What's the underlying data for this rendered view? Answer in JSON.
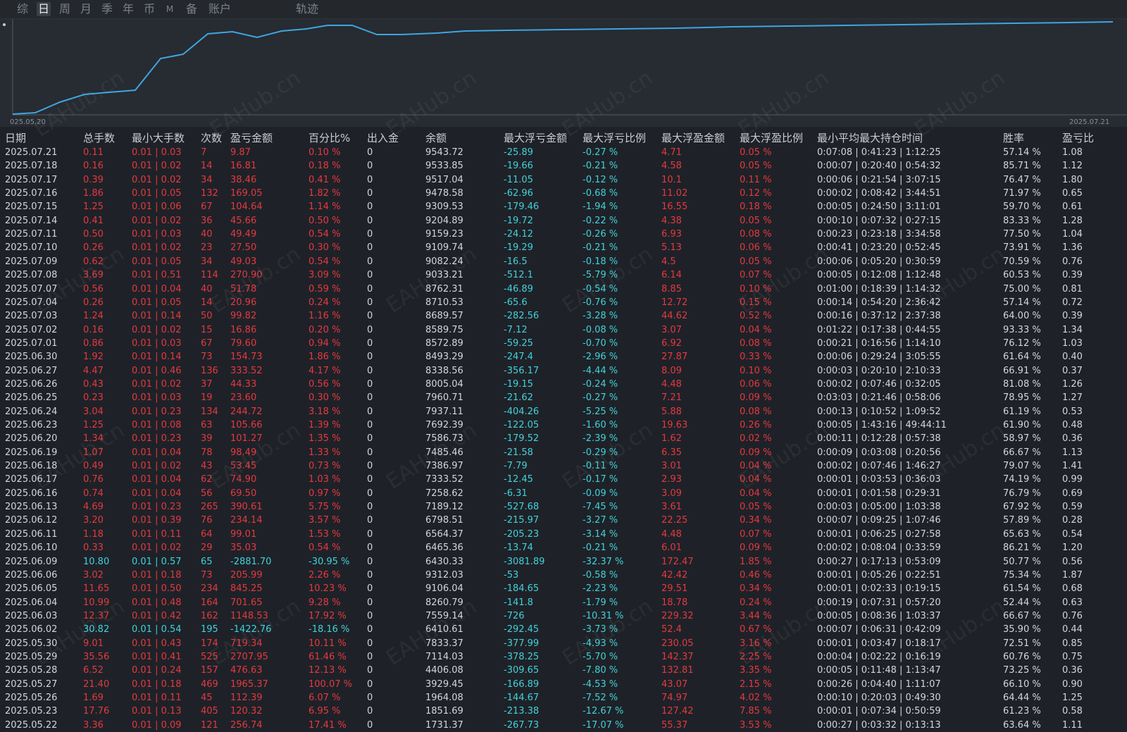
{
  "tabs": [
    "综",
    "日",
    "周",
    "月",
    "季",
    "年",
    "币",
    "M",
    "备",
    "账户",
    "轨迹"
  ],
  "active_tab": "日",
  "chart": {
    "start_date": "025.05.20",
    "end_date": "2025.07.21",
    "line_color": "#3ea6e0"
  },
  "watermark": "EAHub.cn",
  "columns": [
    "日期",
    "总手数",
    "最小大手数",
    "次数",
    "盈亏金额",
    "百分比%",
    "出入金",
    "余额",
    "最大浮亏金额",
    "最大浮亏比例",
    "最大浮盈金额",
    "最大浮盈比例",
    "最小平均最大持仓时间",
    "胜率",
    "盈亏比"
  ],
  "colors": {
    "profit": "#e5393f",
    "loss": "#42d1d9",
    "neutral": "#d3d6db"
  },
  "rows": [
    [
      "2025.07.21",
      "0.11",
      "0.01 | 0.03",
      "7",
      "9.87",
      "0.10 %",
      "0",
      "9543.72",
      "-25.89",
      "-0.27 %",
      "4.71",
      "0.05 %",
      "0:07:08 | 0:41:23 | 1:12:25",
      "57.14 %",
      "1.08"
    ],
    [
      "2025.07.18",
      "0.16",
      "0.01 | 0.02",
      "14",
      "16.81",
      "0.18 %",
      "0",
      "9533.85",
      "-19.66",
      "-0.21 %",
      "4.58",
      "0.05 %",
      "0:00:07 | 0:20:40 | 0:54:32",
      "85.71 %",
      "1.12"
    ],
    [
      "2025.07.17",
      "0.39",
      "0.01 | 0.02",
      "34",
      "38.46",
      "0.41 %",
      "0",
      "9517.04",
      "-11.05",
      "-0.12 %",
      "10.1",
      "0.11 %",
      "0:00:06 | 0:21:54 | 3:07:15",
      "76.47 %",
      "1.80"
    ],
    [
      "2025.07.16",
      "1.86",
      "0.01 | 0.05",
      "132",
      "169.05",
      "1.82 %",
      "0",
      "9478.58",
      "-62.96",
      "-0.68 %",
      "11.02",
      "0.12 %",
      "0:00:02 | 0:08:42 | 3:44:51",
      "71.97 %",
      "0.65"
    ],
    [
      "2025.07.15",
      "1.25",
      "0.01 | 0.06",
      "67",
      "104.64",
      "1.14 %",
      "0",
      "9309.53",
      "-179.46",
      "-1.94 %",
      "16.55",
      "0.18 %",
      "0:00:05 | 0:24:50 | 3:11:01",
      "59.70 %",
      "0.61"
    ],
    [
      "2025.07.14",
      "0.41",
      "0.01 | 0.02",
      "36",
      "45.66",
      "0.50 %",
      "0",
      "9204.89",
      "-19.72",
      "-0.22 %",
      "4.38",
      "0.05 %",
      "0:00:10 | 0:07:32 | 0:27:15",
      "83.33 %",
      "1.28"
    ],
    [
      "2025.07.11",
      "0.50",
      "0.01 | 0.03",
      "40",
      "49.49",
      "0.54 %",
      "0",
      "9159.23",
      "-24.12",
      "-0.26 %",
      "6.93",
      "0.08 %",
      "0:00:23 | 0:23:18 | 3:34:58",
      "77.50 %",
      "1.04"
    ],
    [
      "2025.07.10",
      "0.26",
      "0.01 | 0.02",
      "23",
      "27.50",
      "0.30 %",
      "0",
      "9109.74",
      "-19.29",
      "-0.21 %",
      "5.13",
      "0.06 %",
      "0:00:41 | 0:23:20 | 0:52:45",
      "73.91 %",
      "1.36"
    ],
    [
      "2025.07.09",
      "0.62",
      "0.01 | 0.05",
      "34",
      "49.03",
      "0.54 %",
      "0",
      "9082.24",
      "-16.5",
      "-0.18 %",
      "4.5",
      "0.05 %",
      "0:00:06 | 0:05:20 | 0:30:59",
      "70.59 %",
      "0.76"
    ],
    [
      "2025.07.08",
      "3.69",
      "0.01 | 0.51",
      "114",
      "270.90",
      "3.09 %",
      "0",
      "9033.21",
      "-512.1",
      "-5.79 %",
      "6.14",
      "0.07 %",
      "0:00:05 | 0:12:08 | 1:12:48",
      "60.53 %",
      "0.39"
    ],
    [
      "2025.07.07",
      "0.56",
      "0.01 | 0.04",
      "40",
      "51.78",
      "0.59 %",
      "0",
      "8762.31",
      "-46.89",
      "-0.54 %",
      "8.85",
      "0.10 %",
      "0:01:00 | 0:18:39 | 1:14:32",
      "75.00 %",
      "0.81"
    ],
    [
      "2025.07.04",
      "0.26",
      "0.01 | 0.05",
      "14",
      "20.96",
      "0.24 %",
      "0",
      "8710.53",
      "-65.6",
      "-0.76 %",
      "12.72",
      "0.15 %",
      "0:00:14 | 0:54:20 | 2:36:42",
      "57.14 %",
      "0.72"
    ],
    [
      "2025.07.03",
      "1.24",
      "0.01 | 0.14",
      "50",
      "99.82",
      "1.16 %",
      "0",
      "8689.57",
      "-282.56",
      "-3.28 %",
      "44.62",
      "0.52 %",
      "0:00:16 | 0:37:12 | 2:37:38",
      "64.00 %",
      "0.39"
    ],
    [
      "2025.07.02",
      "0.16",
      "0.01 | 0.02",
      "15",
      "16.86",
      "0.20 %",
      "0",
      "8589.75",
      "-7.12",
      "-0.08 %",
      "3.07",
      "0.04 %",
      "0:01:22 | 0:17:38 | 0:44:55",
      "93.33 %",
      "1.34"
    ],
    [
      "2025.07.01",
      "0.86",
      "0.01 | 0.03",
      "67",
      "79.60",
      "0.94 %",
      "0",
      "8572.89",
      "-59.25",
      "-0.70 %",
      "6.92",
      "0.08 %",
      "0:00:21 | 0:16:56 | 1:14:10",
      "76.12 %",
      "1.03"
    ],
    [
      "2025.06.30",
      "1.92",
      "0.01 | 0.14",
      "73",
      "154.73",
      "1.86 %",
      "0",
      "8493.29",
      "-247.4",
      "-2.96 %",
      "27.87",
      "0.33 %",
      "0:00:06 | 0:29:24 | 3:05:55",
      "61.64 %",
      "0.40"
    ],
    [
      "2025.06.27",
      "4.47",
      "0.01 | 0.46",
      "136",
      "333.52",
      "4.17 %",
      "0",
      "8338.56",
      "-356.17",
      "-4.44 %",
      "8.09",
      "0.10 %",
      "0:00:03 | 0:20:10 | 2:10:33",
      "66.91 %",
      "0.37"
    ],
    [
      "2025.06.26",
      "0.43",
      "0.01 | 0.02",
      "37",
      "44.33",
      "0.56 %",
      "0",
      "8005.04",
      "-19.15",
      "-0.24 %",
      "4.48",
      "0.06 %",
      "0:00:02 | 0:07:46 | 0:32:05",
      "81.08 %",
      "1.26"
    ],
    [
      "2025.06.25",
      "0.23",
      "0.01 | 0.03",
      "19",
      "23.60",
      "0.30 %",
      "0",
      "7960.71",
      "-21.62",
      "-0.27 %",
      "7.21",
      "0.09 %",
      "0:03:03 | 0:21:46 | 0:58:06",
      "78.95 %",
      "1.27"
    ],
    [
      "2025.06.24",
      "3.04",
      "0.01 | 0.23",
      "134",
      "244.72",
      "3.18 %",
      "0",
      "7937.11",
      "-404.26",
      "-5.25 %",
      "5.88",
      "0.08 %",
      "0:00:13 | 0:10:52 | 1:09:52",
      "61.19 %",
      "0.53"
    ],
    [
      "2025.06.23",
      "1.25",
      "0.01 | 0.08",
      "63",
      "105.66",
      "1.39 %",
      "0",
      "7692.39",
      "-122.05",
      "-1.60 %",
      "19.63",
      "0.26 %",
      "0:00:05 | 1:43:16 | 49:44:11",
      "61.90 %",
      "0.48"
    ],
    [
      "2025.06.20",
      "1.34",
      "0.01 | 0.23",
      "39",
      "101.27",
      "1.35 %",
      "0",
      "7586.73",
      "-179.52",
      "-2.39 %",
      "1.62",
      "0.02 %",
      "0:00:11 | 0:12:28 | 0:57:38",
      "58.97 %",
      "0.36"
    ],
    [
      "2025.06.19",
      "1.07",
      "0.01 | 0.04",
      "78",
      "98.49",
      "1.33 %",
      "0",
      "7485.46",
      "-21.58",
      "-0.29 %",
      "6.35",
      "0.09 %",
      "0:00:09 | 0:03:08 | 0:20:56",
      "66.67 %",
      "1.13"
    ],
    [
      "2025.06.18",
      "0.49",
      "0.01 | 0.02",
      "43",
      "53.45",
      "0.73 %",
      "0",
      "7386.97",
      "-7.79",
      "-0.11 %",
      "3.01",
      "0.04 %",
      "0:00:02 | 0:07:46 | 1:46:27",
      "79.07 %",
      "1.41"
    ],
    [
      "2025.06.17",
      "0.76",
      "0.01 | 0.04",
      "62",
      "74.90",
      "1.03 %",
      "0",
      "7333.52",
      "-12.45",
      "-0.17 %",
      "2.93",
      "0.04 %",
      "0:00:01 | 0:03:53 | 0:36:03",
      "74.19 %",
      "0.99"
    ],
    [
      "2025.06.16",
      "0.74",
      "0.01 | 0.04",
      "56",
      "69.50",
      "0.97 %",
      "0",
      "7258.62",
      "-6.31",
      "-0.09 %",
      "3.09",
      "0.04 %",
      "0:00:01 | 0:01:58 | 0:29:31",
      "76.79 %",
      "0.69"
    ],
    [
      "2025.06.13",
      "4.69",
      "0.01 | 0.23",
      "265",
      "390.61",
      "5.75 %",
      "0",
      "7189.12",
      "-527.68",
      "-7.45 %",
      "3.61",
      "0.05 %",
      "0:00:03 | 0:05:00 | 1:03:38",
      "67.92 %",
      "0.59"
    ],
    [
      "2025.06.12",
      "3.20",
      "0.01 | 0.39",
      "76",
      "234.14",
      "3.57 %",
      "0",
      "6798.51",
      "-215.97",
      "-3.27 %",
      "22.25",
      "0.34 %",
      "0:00:07 | 0:09:25 | 1:07:46",
      "57.89 %",
      "0.28"
    ],
    [
      "2025.06.11",
      "1.18",
      "0.01 | 0.11",
      "64",
      "99.01",
      "1.53 %",
      "0",
      "6564.37",
      "-205.23",
      "-3.14 %",
      "4.48",
      "0.07 %",
      "0:00:01 | 0:06:25 | 0:27:58",
      "65.63 %",
      "0.54"
    ],
    [
      "2025.06.10",
      "0.33",
      "0.01 | 0.02",
      "29",
      "35.03",
      "0.54 %",
      "0",
      "6465.36",
      "-13.74",
      "-0.21 %",
      "6.01",
      "0.09 %",
      "0:00:02 | 0:08:04 | 0:33:59",
      "86.21 %",
      "1.20"
    ],
    [
      "2025.06.09",
      "10.80",
      "0.01 | 0.57",
      "65",
      "-2881.70",
      "-30.95 %",
      "0",
      "6430.33",
      "-3081.89",
      "-32.37 %",
      "172.47",
      "1.85 %",
      "0:00:27 | 0:17:13 | 0:53:09",
      "50.77 %",
      "0.56"
    ],
    [
      "2025.06.06",
      "3.02",
      "0.01 | 0.18",
      "73",
      "205.99",
      "2.26 %",
      "0",
      "9312.03",
      "-53",
      "-0.58 %",
      "42.42",
      "0.46 %",
      "0:00:01 | 0:05:26 | 0:22:51",
      "75.34 %",
      "1.87"
    ],
    [
      "2025.06.05",
      "11.65",
      "0.01 | 0.50",
      "234",
      "845.25",
      "10.23 %",
      "0",
      "9106.04",
      "-184.65",
      "-2.23 %",
      "29.51",
      "0.34 %",
      "0:00:01 | 0:02:33 | 0:19:15",
      "61.54 %",
      "0.68"
    ],
    [
      "2025.06.04",
      "10.99",
      "0.01 | 0.48",
      "164",
      "701.65",
      "9.28 %",
      "0",
      "8260.79",
      "-141.8",
      "-1.79 %",
      "18.78",
      "0.24 %",
      "0:00:19 | 0:07:31 | 0:57:20",
      "52.44 %",
      "0.63"
    ],
    [
      "2025.06.03",
      "12.37",
      "0.01 | 0.42",
      "162",
      "1148.53",
      "17.92 %",
      "0",
      "7559.14",
      "-726",
      "-10.31 %",
      "229.32",
      "3.44 %",
      "0:00:05 | 0:08:36 | 1:03:37",
      "66.67 %",
      "0.76"
    ],
    [
      "2025.06.02",
      "30.82",
      "0.01 | 0.54",
      "195",
      "-1422.76",
      "-18.16 %",
      "0",
      "6410.61",
      "-292.45",
      "-3.73 %",
      "52.4",
      "0.67 %",
      "0:00:07 | 0:06:31 | 0:42:09",
      "35.90 %",
      "0.44"
    ],
    [
      "2025.05.30",
      "9.01",
      "0.01 | 0.43",
      "174",
      "719.34",
      "10.11 %",
      "0",
      "7833.37",
      "-377.99",
      "-4.93 %",
      "230.05",
      "3.16 %",
      "0:00:01 | 0:03:47 | 0:18:17",
      "72.51 %",
      "0.85"
    ],
    [
      "2025.05.29",
      "35.56",
      "0.01 | 0.41",
      "525",
      "2707.95",
      "61.46 %",
      "0",
      "7114.03",
      "-378.25",
      "-5.70 %",
      "142.37",
      "2.25 %",
      "0:00:04 | 0:02:22 | 0:16:19",
      "60.76 %",
      "0.75"
    ],
    [
      "2025.05.28",
      "6.52",
      "0.01 | 0.24",
      "157",
      "476.63",
      "12.13 %",
      "0",
      "4406.08",
      "-309.65",
      "-7.80 %",
      "132.81",
      "3.35 %",
      "0:00:05 | 0:11:48 | 1:13:47",
      "73.25 %",
      "0.36"
    ],
    [
      "2025.05.27",
      "21.40",
      "0.01 | 0.18",
      "469",
      "1965.37",
      "100.07 %",
      "0",
      "3929.45",
      "-166.89",
      "-4.53 %",
      "43.07",
      "2.15 %",
      "0:00:26 | 0:04:40 | 1:11:07",
      "66.10 %",
      "0.90"
    ],
    [
      "2025.05.26",
      "1.69",
      "0.01 | 0.11",
      "45",
      "112.39",
      "6.07 %",
      "0",
      "1964.08",
      "-144.67",
      "-7.52 %",
      "74.97",
      "4.02 %",
      "0:00:10 | 0:20:03 | 0:49:30",
      "64.44 %",
      "1.25"
    ],
    [
      "2025.05.23",
      "17.76",
      "0.01 | 0.13",
      "405",
      "120.32",
      "6.95 %",
      "0",
      "1851.69",
      "-213.38",
      "-12.67 %",
      "127.42",
      "7.85 %",
      "0:00:01 | 0:07:34 | 0:50:59",
      "61.23 %",
      "0.58"
    ],
    [
      "2025.05.22",
      "3.36",
      "0.01 | 0.09",
      "121",
      "256.74",
      "17.41 %",
      "0",
      "1731.37",
      "-267.73",
      "-17.07 %",
      "55.37",
      "3.53 %",
      "0:00:27 | 0:03:32 | 0:13:13",
      "63.64 %",
      "1.11"
    ]
  ]
}
